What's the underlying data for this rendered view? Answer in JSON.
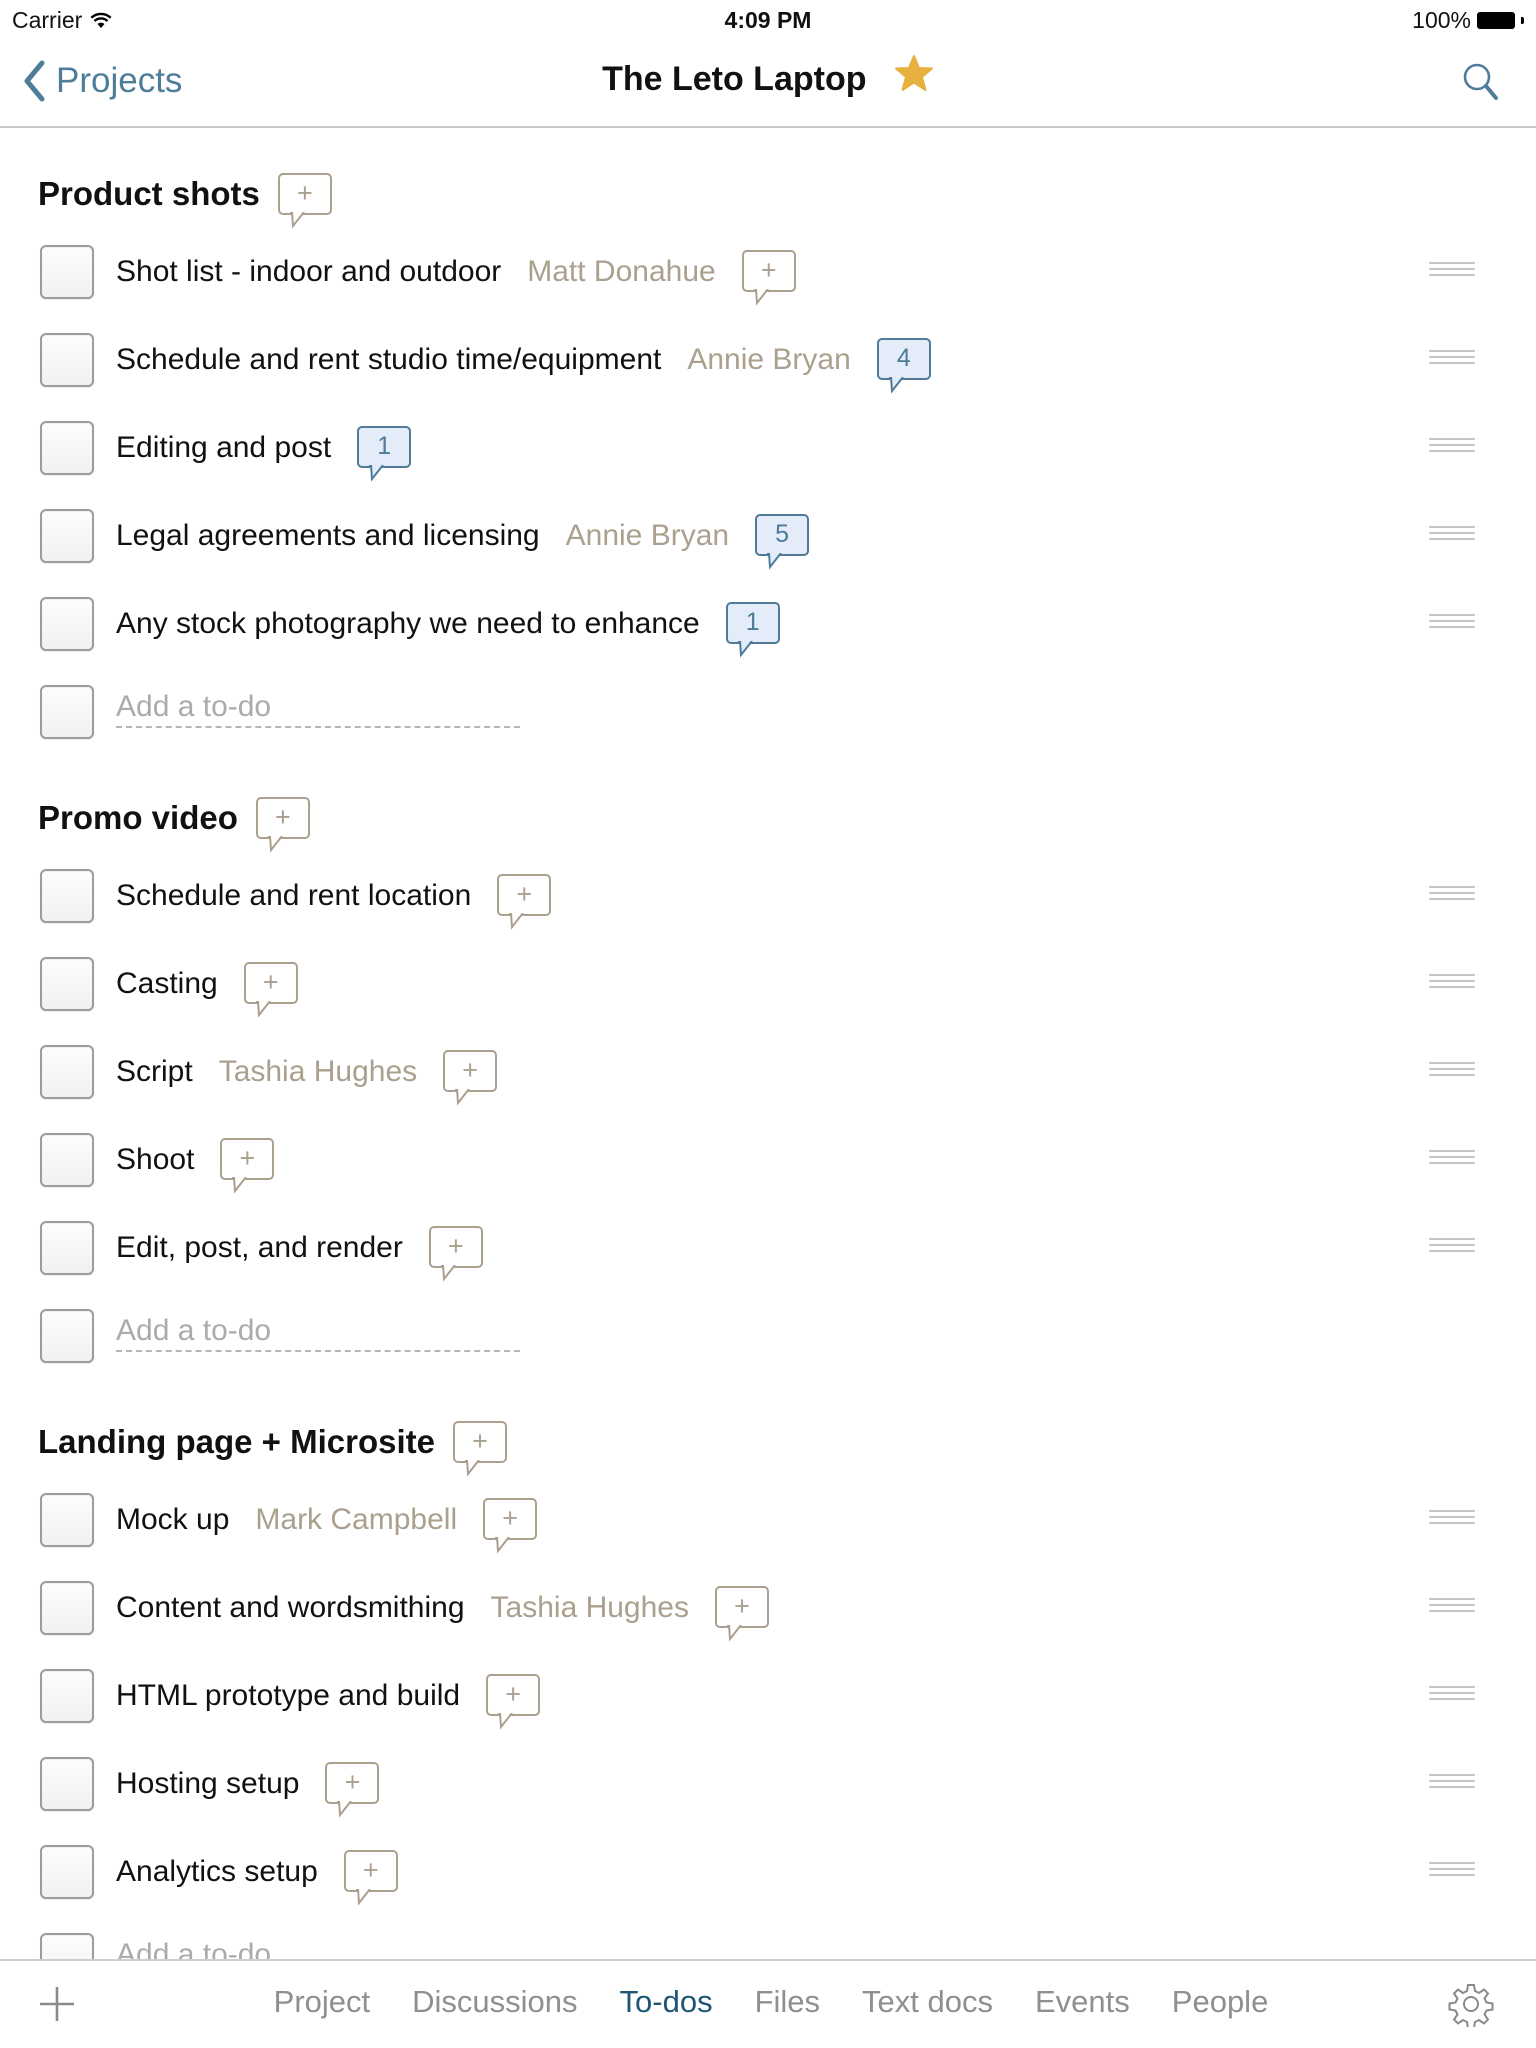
{
  "status_bar": {
    "carrier": "Carrier",
    "time": "4:09 PM",
    "battery": "100%"
  },
  "nav": {
    "back_label": "Projects",
    "title": "The Leto Laptop",
    "starred": true,
    "icons": {
      "back": "chevron-left-icon",
      "star": "star-icon",
      "search": "search-icon"
    }
  },
  "colors": {
    "accent": "#4e7d99",
    "assignee": "#ab9f8d",
    "star": "#e8b03d",
    "active_tab": "#1f5575",
    "comment_count_bg": "#e3ecf8"
  },
  "lists": [
    {
      "title": "Product shots",
      "items": [
        {
          "text": "Shot list - indoor and outdoor",
          "assignee": "Matt Donahue",
          "comments": "+"
        },
        {
          "text": "Schedule and rent studio time/equipment",
          "assignee": "Annie Bryan",
          "comments": "4"
        },
        {
          "text": "Editing and post",
          "assignee": "",
          "comments": "1"
        },
        {
          "text": "Legal agreements and licensing",
          "assignee": "Annie Bryan",
          "comments": "5"
        },
        {
          "text": "Any stock photography we need to enhance",
          "assignee": "",
          "comments": "1"
        }
      ],
      "add_placeholder": "Add a to-do"
    },
    {
      "title": "Promo video",
      "items": [
        {
          "text": "Schedule and rent location",
          "assignee": "",
          "comments": "+"
        },
        {
          "text": "Casting",
          "assignee": "",
          "comments": "+"
        },
        {
          "text": "Script",
          "assignee": "Tashia Hughes",
          "comments": "+"
        },
        {
          "text": "Shoot",
          "assignee": "",
          "comments": "+"
        },
        {
          "text": "Edit, post, and render",
          "assignee": "",
          "comments": "+"
        }
      ],
      "add_placeholder": "Add a to-do"
    },
    {
      "title": "Landing page + Microsite",
      "items": [
        {
          "text": "Mock up",
          "assignee": "Mark Campbell",
          "comments": "+"
        },
        {
          "text": "Content and wordsmithing",
          "assignee": "Tashia Hughes",
          "comments": "+"
        },
        {
          "text": "HTML prototype and build",
          "assignee": "",
          "comments": "+"
        },
        {
          "text": "Hosting setup",
          "assignee": "",
          "comments": "+"
        },
        {
          "text": "Analytics setup",
          "assignee": "",
          "comments": "+"
        }
      ],
      "add_placeholder": "Add a to-do"
    }
  ],
  "section_add_comment": "+",
  "tabbar": {
    "tabs": [
      "Project",
      "Discussions",
      "To-dos",
      "Files",
      "Text docs",
      "Events",
      "People"
    ],
    "active": "To-dos",
    "icons": {
      "add": "plus-icon",
      "settings": "gear-icon"
    }
  }
}
